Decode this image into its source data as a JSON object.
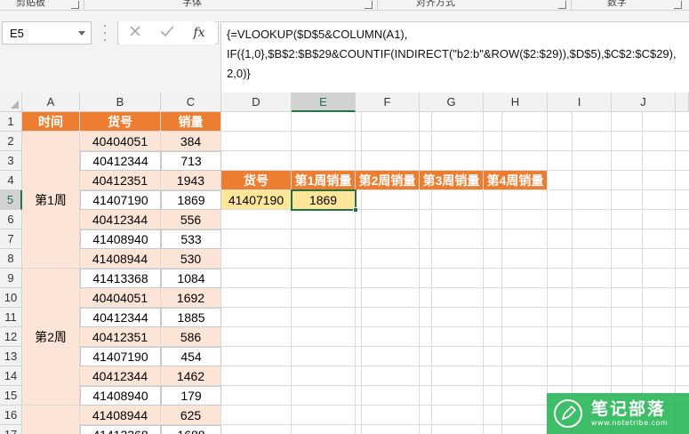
{
  "ribbon": {
    "groups": [
      {
        "label": "剪贴板"
      },
      {
        "label": "字体"
      },
      {
        "label": "对齐方式"
      },
      {
        "label": "数字"
      }
    ]
  },
  "formula_bar": {
    "name_box": "E5",
    "cancel_icon": "close-icon",
    "enter_icon": "check-icon",
    "fx_label": "fx",
    "formula_lines": [
      "{=VLOOKUP($D$5&COLUMN(A1),",
      "IF({1,0},$B$2:$B$29&COUNTIF(INDIRECT(\"b2:b\"&ROW($2:$29)),$D$5),$C$2:$C$29),",
      "2,0)}"
    ]
  },
  "grid": {
    "selected_cell": "E5",
    "columns": [
      "A",
      "B",
      "C",
      "D",
      "E",
      "F",
      "G",
      "H",
      "I",
      "J"
    ],
    "rows": [
      "1",
      "2",
      "3",
      "4",
      "5",
      "6",
      "7",
      "8",
      "9",
      "10",
      "11",
      "12",
      "13",
      "14",
      "15",
      "16",
      "17"
    ],
    "table_header": {
      "time": "时间",
      "item_no": "货号",
      "sales": "销量"
    },
    "week_labels": {
      "week1": "第1周",
      "week2": "第2周"
    },
    "data_rows": [
      {
        "item": "40404051",
        "sales": "384"
      },
      {
        "item": "40412344",
        "sales": "713"
      },
      {
        "item": "40412351",
        "sales": "1943"
      },
      {
        "item": "41407190",
        "sales": "1869"
      },
      {
        "item": "40412344",
        "sales": "556"
      },
      {
        "item": "41408940",
        "sales": "533"
      },
      {
        "item": "41408944",
        "sales": "530"
      },
      {
        "item": "41413368",
        "sales": "1084"
      },
      {
        "item": "40404051",
        "sales": "1692"
      },
      {
        "item": "40412344",
        "sales": "1885"
      },
      {
        "item": "40412351",
        "sales": "586"
      },
      {
        "item": "41407190",
        "sales": "454"
      },
      {
        "item": "40412344",
        "sales": "1462"
      },
      {
        "item": "41408940",
        "sales": "179"
      },
      {
        "item": "41408944",
        "sales": "625"
      },
      {
        "item": "41413368",
        "sales": "1688"
      }
    ],
    "lookup_header": [
      "货号",
      "第1周销量",
      "第2周销量",
      "第3周销量",
      "第4周销量"
    ],
    "lookup_values": {
      "item": "41407190",
      "week1": "1869"
    }
  },
  "colors": {
    "header_orange": "#ed7d31",
    "pink_fill": "#fce4d6",
    "yellow_fill": "#ffe699",
    "excel_green": "#217346",
    "watermark_green": "#2eb85c"
  },
  "watermark": {
    "title": "笔记部落",
    "url": "www.notetribe.com",
    "icon": "pen-logo-icon"
  }
}
